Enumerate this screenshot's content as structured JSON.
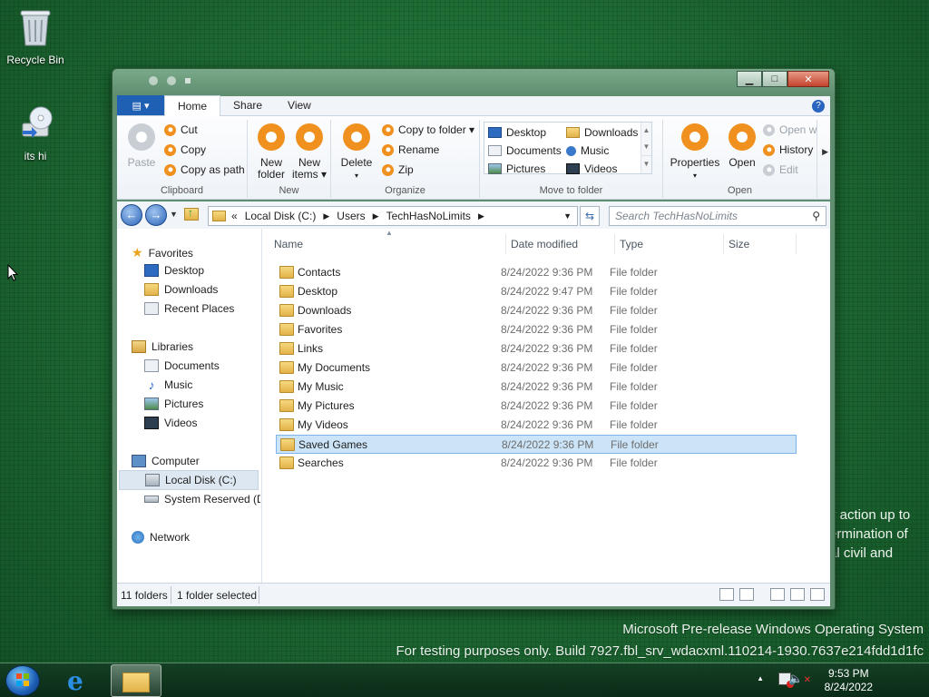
{
  "desktop": {
    "icons": [
      {
        "label": "Recycle Bin"
      },
      {
        "label": "its hi"
      }
    ],
    "behind_text": [
      "y action up to",
      "ermination of",
      "al civil and"
    ],
    "watermark": {
      "line1": "Microsoft Pre-release Windows Operating System",
      "line2": "For testing purposes only. Build 7927.fbl_srv_wdacxml.110214-1930.7637e214fdd1d1fc"
    }
  },
  "window": {
    "ribbon_tabs": [
      "Home",
      "Share",
      "View"
    ],
    "active_tab": "Home",
    "help": "?",
    "clipboard": {
      "paste": "Paste",
      "cut": "Cut",
      "copy": "Copy",
      "copy_as_path": "Copy as path",
      "label": "Clipboard"
    },
    "new": {
      "new_folder_l1": "New",
      "new_folder_l2": "folder",
      "new_items_l1": "New",
      "new_items_l2": "items ▾",
      "label": "New"
    },
    "organize": {
      "delete": "Delete",
      "delete_caret": "▾",
      "copy_to_folder": "Copy to folder ▾",
      "rename": "Rename",
      "zip": "Zip",
      "label": "Organize"
    },
    "move_to_folder": {
      "items": [
        "Desktop",
        "Downloads",
        "Documents",
        "Music",
        "Pictures",
        "Videos"
      ],
      "label": "Move to folder"
    },
    "open": {
      "properties": "Properties",
      "properties_caret": "▾",
      "open": "Open",
      "open_with": "Open w",
      "history": "History",
      "edit": "Edit",
      "label": "Open"
    },
    "address": {
      "prefix": "«",
      "segments": [
        "Local Disk (C:)",
        "Users",
        "TechHasNoLimits"
      ]
    },
    "search_placeholder": "Search TechHasNoLimits",
    "nav": {
      "favorites": "Favorites",
      "favorites_items": [
        "Desktop",
        "Downloads",
        "Recent Places"
      ],
      "libraries": "Libraries",
      "libraries_items": [
        "Documents",
        "Music",
        "Pictures",
        "Videos"
      ],
      "computer": "Computer",
      "computer_items": [
        "Local Disk (C:)",
        "System Reserved (D:"
      ],
      "network": "Network"
    },
    "columns": [
      "Name",
      "Date modified",
      "Type",
      "Size"
    ],
    "files": [
      {
        "name": "Contacts",
        "date": "8/24/2022 9:36 PM",
        "type": "File folder"
      },
      {
        "name": "Desktop",
        "date": "8/24/2022 9:47 PM",
        "type": "File folder"
      },
      {
        "name": "Downloads",
        "date": "8/24/2022 9:36 PM",
        "type": "File folder"
      },
      {
        "name": "Favorites",
        "date": "8/24/2022 9:36 PM",
        "type": "File folder"
      },
      {
        "name": "Links",
        "date": "8/24/2022 9:36 PM",
        "type": "File folder"
      },
      {
        "name": "My Documents",
        "date": "8/24/2022 9:36 PM",
        "type": "File folder"
      },
      {
        "name": "My Music",
        "date": "8/24/2022 9:36 PM",
        "type": "File folder"
      },
      {
        "name": "My Pictures",
        "date": "8/24/2022 9:36 PM",
        "type": "File folder"
      },
      {
        "name": "My Videos",
        "date": "8/24/2022 9:36 PM",
        "type": "File folder"
      },
      {
        "name": "Saved Games",
        "date": "8/24/2022 9:36 PM",
        "type": "File folder"
      },
      {
        "name": "Searches",
        "date": "8/24/2022 9:36 PM",
        "type": "File folder"
      }
    ],
    "selected_file": "Saved Games",
    "status": {
      "count": "11 folders",
      "selection": "1 folder selected"
    }
  },
  "taskbar": {
    "time": "9:53 PM",
    "date": "8/24/2022",
    "tray_arrow": "▲"
  },
  "colors": {
    "accent": "#1f5fb4",
    "selection": "#cce4f7",
    "icon_orange": "#f0901e",
    "desktop": "#1e6b34"
  }
}
